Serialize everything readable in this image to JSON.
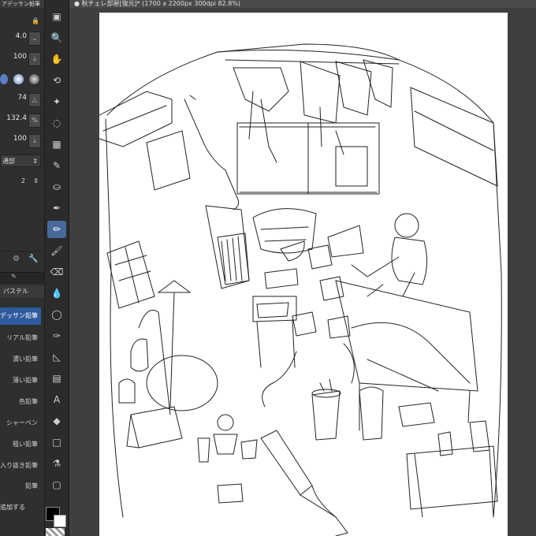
{
  "document": {
    "tab_title": "● 秋チェレ部屋[復元]* (1700 x 2200px 300dpi 82.8%)"
  },
  "tool_property": {
    "brush_name": "アデッサン鉛筆",
    "size": "4.0",
    "opacity": "100",
    "density": "74",
    "angle": "132.4",
    "flow": "100",
    "blend_label": "通部",
    "count": "2"
  },
  "subtool_group": {
    "label": "パステル"
  },
  "brushes": [
    {
      "label": "デッサン鉛筆",
      "selected": true
    },
    {
      "label": "リアル鉛筆",
      "selected": false
    },
    {
      "label": "濃い鉛筆",
      "selected": false
    },
    {
      "label": "薄い鉛筆",
      "selected": false
    },
    {
      "label": "色鉛筆",
      "selected": false
    },
    {
      "label": "シャーペン",
      "selected": false
    },
    {
      "label": "粗い鉛筆",
      "selected": false
    },
    {
      "label": "入り抜き鉛筆",
      "selected": false
    },
    {
      "label": "鉛筆",
      "selected": false
    }
  ],
  "add_button_label": "追加する",
  "tools": [
    {
      "name": "layer-move-icon",
      "glyph": "▣"
    },
    {
      "name": "zoom-icon",
      "glyph": "🔍"
    },
    {
      "name": "hand-icon",
      "glyph": "✋"
    },
    {
      "name": "rotate-icon",
      "glyph": "⟲"
    },
    {
      "name": "auto-select-icon",
      "glyph": "✦"
    },
    {
      "name": "lasso-icon",
      "glyph": "◌"
    },
    {
      "name": "mesh-icon",
      "glyph": "▦"
    },
    {
      "name": "eyedropper-icon",
      "glyph": "✎"
    },
    {
      "name": "fill-spray-icon",
      "glyph": "⛀"
    },
    {
      "name": "pen-icon",
      "glyph": "✒"
    },
    {
      "name": "pencil-icon",
      "glyph": "✏"
    },
    {
      "name": "brush-icon",
      "glyph": "🖌"
    },
    {
      "name": "eraser-icon",
      "glyph": "⌫"
    },
    {
      "name": "blend-icon",
      "glyph": "💧"
    },
    {
      "name": "figure-icon",
      "glyph": "◯"
    },
    {
      "name": "vector-pen-icon",
      "glyph": "✑"
    },
    {
      "name": "ruler-icon",
      "glyph": "◺"
    },
    {
      "name": "gradient-icon",
      "glyph": "▤"
    },
    {
      "name": "text-icon",
      "glyph": "A"
    },
    {
      "name": "paint-bucket-icon",
      "glyph": "◆"
    },
    {
      "name": "rectangle-icon",
      "glyph": "□"
    },
    {
      "name": "correction-icon",
      "glyph": "⚗"
    },
    {
      "name": "frame-icon",
      "glyph": "▢"
    }
  ],
  "colors": {
    "main": "#000000",
    "sub": "#ffffff",
    "accent": "#2e5a9e"
  }
}
